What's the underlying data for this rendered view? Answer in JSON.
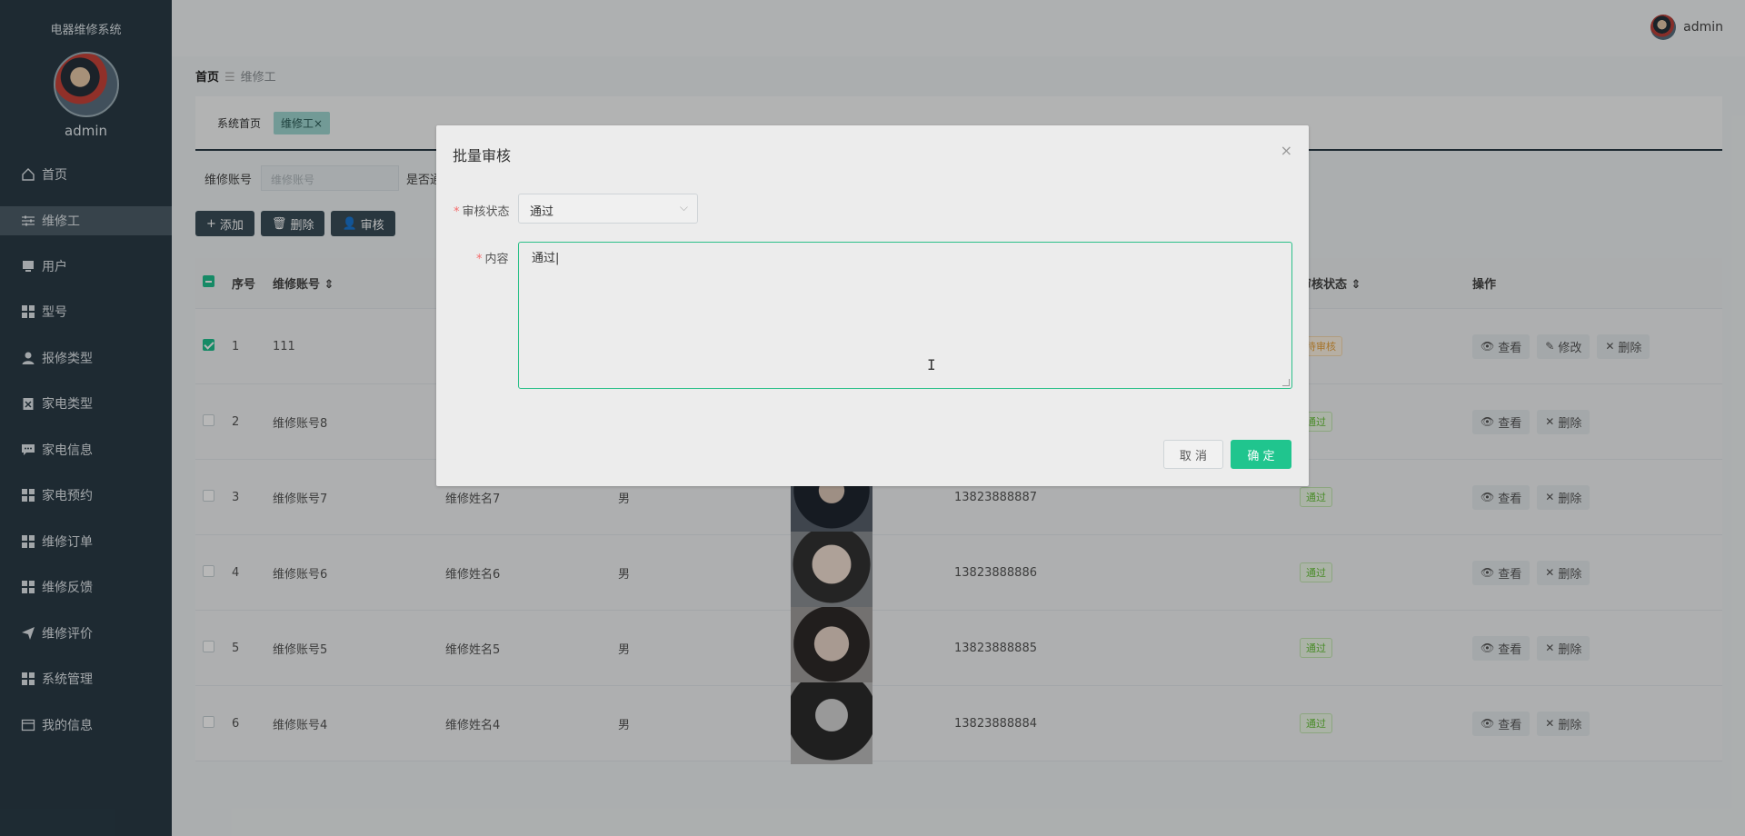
{
  "sidebar": {
    "brand": "电器维修系统",
    "admin_name": "admin",
    "items": [
      {
        "label": "首页",
        "icon": "home-icon"
      },
      {
        "label": "维修工",
        "icon": "sliders-icon"
      },
      {
        "label": "用户",
        "icon": "monitor-icon"
      },
      {
        "label": "型号",
        "icon": "grid-icon"
      },
      {
        "label": "报修类型",
        "icon": "user-icon"
      },
      {
        "label": "家电类型",
        "icon": "clipboard-icon"
      },
      {
        "label": "家电信息",
        "icon": "chat-icon"
      },
      {
        "label": "家电预约",
        "icon": "grid-icon"
      },
      {
        "label": "维修订单",
        "icon": "grid-icon"
      },
      {
        "label": "维修反馈",
        "icon": "grid-icon"
      },
      {
        "label": "维修评价",
        "icon": "send-icon"
      },
      {
        "label": "系统管理",
        "icon": "grid-icon"
      },
      {
        "label": "我的信息",
        "icon": "card-icon"
      }
    ]
  },
  "header": {
    "username": "admin"
  },
  "breadcrumb": {
    "home": "首页",
    "current": "维修工"
  },
  "tabs": [
    {
      "label": "系统首页"
    },
    {
      "label": "维修工",
      "close": "×"
    }
  ],
  "search": {
    "label": "维修账号",
    "placeholder": "维修账号",
    "label2": "是否通"
  },
  "toolbar": {
    "add": "添加",
    "delete": "删除",
    "audit": "审核"
  },
  "table": {
    "headers": {
      "index": "序号",
      "account": "维修账号 ⇕",
      "status": "审核状态 ⇕",
      "ops": "操作"
    },
    "rows": [
      {
        "index": "1",
        "account": "111",
        "name": "",
        "gender": "",
        "phone": "",
        "status": "待审核",
        "ops": [
          "查看",
          "修改",
          "删除"
        ]
      },
      {
        "index": "2",
        "account": "维修账号8",
        "name": "",
        "gender": "",
        "phone": "",
        "status": "通过",
        "ops": [
          "查看",
          "删除"
        ]
      },
      {
        "index": "3",
        "account": "维修账号7",
        "name": "维修姓名7",
        "gender": "男",
        "phone": "13823888887",
        "status": "通过",
        "ops": [
          "查看",
          "删除"
        ]
      },
      {
        "index": "4",
        "account": "维修账号6",
        "name": "维修姓名6",
        "gender": "男",
        "phone": "13823888886",
        "status": "通过",
        "ops": [
          "查看",
          "删除"
        ]
      },
      {
        "index": "5",
        "account": "维修账号5",
        "name": "维修姓名5",
        "gender": "男",
        "phone": "13823888885",
        "status": "通过",
        "ops": [
          "查看",
          "删除"
        ]
      },
      {
        "index": "6",
        "account": "维修账号4",
        "name": "维修姓名4",
        "gender": "男",
        "phone": "13823888884",
        "status": "通过",
        "ops": [
          "查看",
          "删除"
        ]
      }
    ]
  },
  "modal": {
    "title": "批量审核",
    "status_label": "审核状态",
    "status_value": "通过",
    "content_label": "内容",
    "content_value": "通过|",
    "cancel": "取 消",
    "confirm": "确 定",
    "close": "×",
    "cursor": "I"
  },
  "colors": {
    "sidebar": "#2a3b46",
    "accent": "#20c58e",
    "overlay": "rgba(0,0,0,0.28)"
  }
}
